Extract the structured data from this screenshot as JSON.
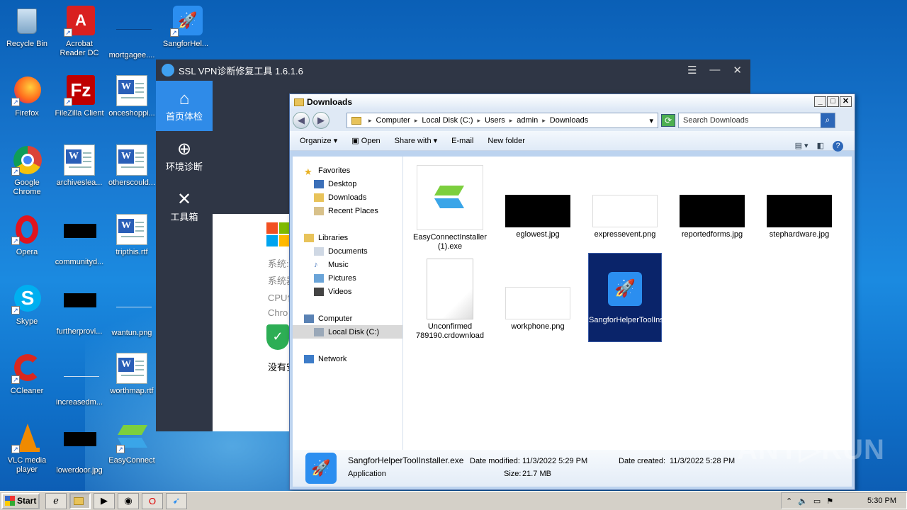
{
  "desktop": {
    "icons": [
      {
        "label": "Recycle Bin"
      },
      {
        "label": "Acrobat Reader DC"
      },
      {
        "label": "mortgagee...."
      },
      {
        "label": "SangforHel..."
      },
      {
        "label": "Firefox"
      },
      {
        "label": "FileZilla Client"
      },
      {
        "label": "onceshoppi..."
      },
      {
        "label": "Google Chrome"
      },
      {
        "label": "archiveslea..."
      },
      {
        "label": "otherscould..."
      },
      {
        "label": "Opera"
      },
      {
        "label": "communityd..."
      },
      {
        "label": "tripthis.rtf"
      },
      {
        "label": "Skype"
      },
      {
        "label": "furtherprovi..."
      },
      {
        "label": "wantun.png"
      },
      {
        "label": "CCleaner"
      },
      {
        "label": "increasedm..."
      },
      {
        "label": "worthmap.rtf"
      },
      {
        "label": "VLC media player"
      },
      {
        "label": "lowerdoor.jpg"
      },
      {
        "label": "EasyConnect"
      }
    ]
  },
  "vpn": {
    "title": "SSL VPN诊断修复工具 1.6.1.6",
    "controls": [
      "☰",
      "—",
      "✕"
    ],
    "nav": [
      {
        "label": "首页体检",
        "icon": "home-icon"
      },
      {
        "label": "环境诊断",
        "icon": "target-icon"
      },
      {
        "label": "工具箱",
        "icon": "tools-icon"
      }
    ],
    "partial_lines": [
      "系统:",
      "系统器",
      "CPU使",
      "Chro"
    ],
    "status_text": "没有安"
  },
  "explorer": {
    "title": "Downloads",
    "breadcrumb": [
      "Computer",
      "Local Disk (C:)",
      "Users",
      "admin",
      "Downloads"
    ],
    "search_placeholder": "Search Downloads",
    "toolbar": {
      "organize": "Organize",
      "open": "Open",
      "share_with": "Share with",
      "email": "E-mail",
      "new_folder": "New folder"
    },
    "nav": {
      "favorites": "Favorites",
      "desktop": "Desktop",
      "downloads": "Downloads",
      "recent": "Recent Places",
      "libraries": "Libraries",
      "documents": "Documents",
      "music": "Music",
      "pictures": "Pictures",
      "videos": "Videos",
      "computer": "Computer",
      "local_disk": "Local Disk (C:)",
      "network": "Network"
    },
    "files": [
      {
        "name": "EasyConnectInstaller (1).exe"
      },
      {
        "name": "eglowest.jpg"
      },
      {
        "name": "expressevent.png"
      },
      {
        "name": "reportedforms.jpg"
      },
      {
        "name": "stephardware.jpg"
      },
      {
        "name": "Unconfirmed 789190.crdownload"
      },
      {
        "name": "workphone.png"
      },
      {
        "name": "SangforHelperToolInstaller.exe"
      }
    ],
    "details": {
      "filename": "SangforHelperToolInstaller.exe",
      "type": "Application",
      "date_modified_label": "Date modified:",
      "date_modified": "11/3/2022 5:29 PM",
      "size_label": "Size:",
      "size": "21.7 MB",
      "date_created_label": "Date created:",
      "date_created": "11/3/2022 5:28 PM"
    }
  },
  "taskbar": {
    "start": "Start",
    "clock": "5:30 PM"
  },
  "watermark": "ANY▷RUN"
}
